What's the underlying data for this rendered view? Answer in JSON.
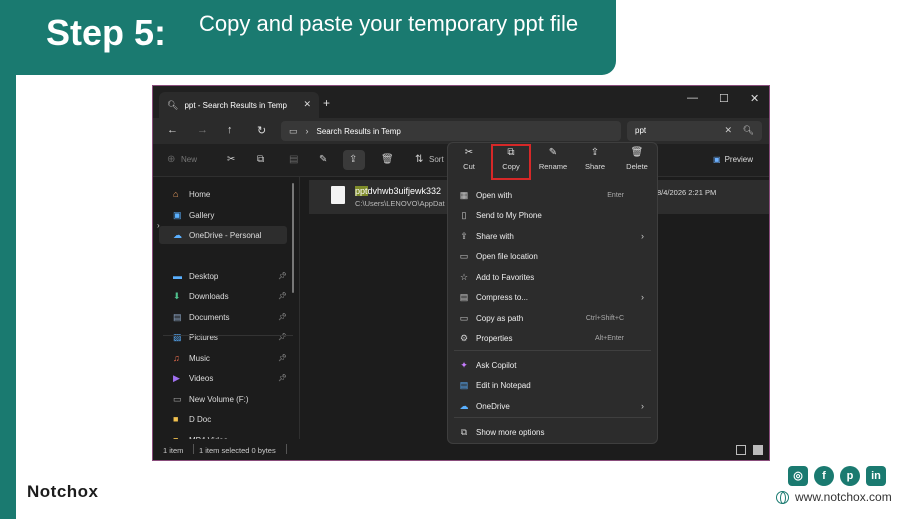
{
  "banner": {
    "step": "Step 5:",
    "text": "Copy and paste your temporary ppt file"
  },
  "window": {
    "tab_title": "ppt - Search Results in Temp",
    "new_tab": "+",
    "address": "Search Results in Temp",
    "search_value": "ppt",
    "toolbar": {
      "new_label": "New",
      "sort_label": "Sort",
      "preview_label": "Preview"
    },
    "sidebar": {
      "items": [
        {
          "label": "Home",
          "icon": "home-icon",
          "glyph": "⌂",
          "color": "#f0a060"
        },
        {
          "label": "Gallery",
          "icon": "gallery-icon",
          "glyph": "▣",
          "color": "#5ab0ff"
        },
        {
          "label": "OneDrive - Personal",
          "icon": "cloud-icon",
          "glyph": "☁",
          "color": "#5ab0ff"
        },
        {
          "label": "Desktop",
          "icon": "desktop-icon",
          "glyph": "▬",
          "color": "#5ab0ff"
        },
        {
          "label": "Downloads",
          "icon": "download-icon",
          "glyph": "⬇",
          "color": "#4fc08d"
        },
        {
          "label": "Documents",
          "icon": "documents-icon",
          "glyph": "▤",
          "color": "#8fa8c8"
        },
        {
          "label": "Pictures",
          "icon": "pictures-icon",
          "glyph": "▨",
          "color": "#5ab0ff"
        },
        {
          "label": "Music",
          "icon": "music-icon",
          "glyph": "♫",
          "color": "#f07050"
        },
        {
          "label": "Videos",
          "icon": "videos-icon",
          "glyph": "▶",
          "color": "#a070f0"
        },
        {
          "label": "New Volume (F:)",
          "icon": "drive-icon",
          "glyph": "▭",
          "color": "#aaaaaa"
        },
        {
          "label": "D Doc",
          "icon": "folder-icon",
          "glyph": "■",
          "color": "#f2c14e"
        },
        {
          "label": "MP4 Video",
          "icon": "folder-icon",
          "glyph": "■",
          "color": "#f2c14e"
        }
      ]
    },
    "file": {
      "name_highlight": "ppt",
      "name_rest": "dvhwb3uifjewk332",
      "path": "C:\\Users\\LENOVO\\AppDat",
      "date": "8/4/2026 2:21 PM"
    },
    "status": {
      "count": "1 item",
      "selected": "1 item selected  0 bytes"
    },
    "context_menu": {
      "actions": [
        {
          "label": "Cut",
          "icon": "scissors-icon",
          "glyph": "✂"
        },
        {
          "label": "Copy",
          "icon": "copy-icon",
          "glyph": "⧉"
        },
        {
          "label": "Rename",
          "icon": "rename-icon",
          "glyph": "✎"
        },
        {
          "label": "Share",
          "icon": "share-icon",
          "glyph": "⇪"
        },
        {
          "label": "Delete",
          "icon": "trash-icon",
          "glyph": "🗑"
        }
      ],
      "items": [
        {
          "label": "Open with",
          "shortcut": "Enter",
          "icon": "open-with-icon",
          "glyph": "▦"
        },
        {
          "label": "Send to My Phone",
          "shortcut": "",
          "icon": "phone-icon",
          "glyph": "▯"
        },
        {
          "label": "Share with",
          "shortcut": "",
          "icon": "share-with-icon",
          "glyph": "⇪"
        },
        {
          "label": "Open file location",
          "shortcut": "",
          "icon": "folder-open-icon",
          "glyph": "▭"
        },
        {
          "label": "Add to Favorites",
          "shortcut": "",
          "icon": "star-icon",
          "glyph": "☆"
        },
        {
          "label": "Compress to...",
          "shortcut": "",
          "icon": "zip-icon",
          "glyph": "▤"
        },
        {
          "label": "Copy as path",
          "shortcut": "Ctrl+Shift+C",
          "icon": "copy-path-icon",
          "glyph": "▭"
        },
        {
          "label": "Properties",
          "shortcut": "Alt+Enter",
          "icon": "wrench-icon",
          "glyph": "⚙"
        },
        {
          "label": "Ask Copilot",
          "shortcut": "",
          "icon": "copilot-icon",
          "glyph": "✦"
        },
        {
          "label": "Edit in Notepad",
          "shortcut": "",
          "icon": "notepad-icon",
          "glyph": "▤"
        },
        {
          "label": "OneDrive",
          "shortcut": "",
          "icon": "onedrive-icon",
          "glyph": "☁"
        },
        {
          "label": "Show more options",
          "shortcut": "",
          "icon": "more-options-icon",
          "glyph": "⧉"
        }
      ]
    }
  },
  "footer": {
    "logo": "Notchox",
    "website": "www.notchox.com"
  },
  "colors": {
    "brand": "#1a7a70",
    "highlight": "#d62828"
  }
}
